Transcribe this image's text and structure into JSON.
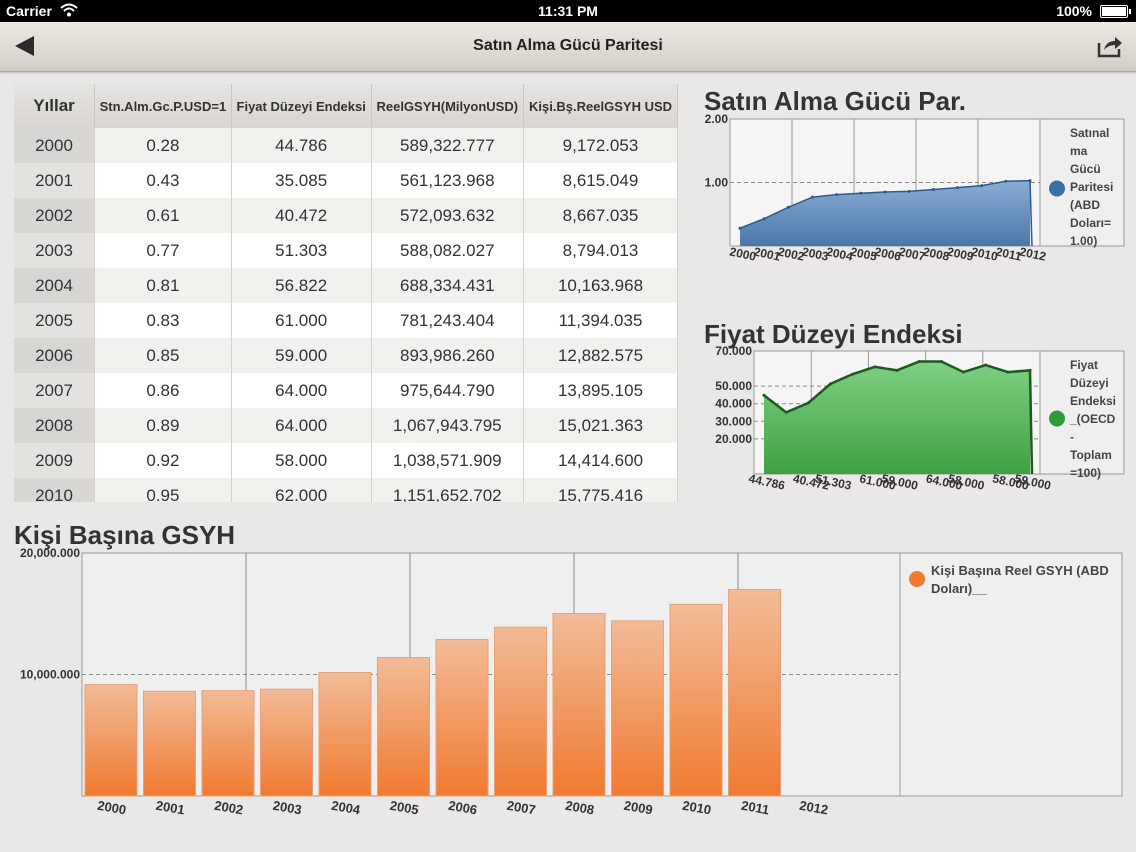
{
  "status_bar": {
    "carrier": "Carrier",
    "time": "11:31 PM",
    "battery": "100%"
  },
  "nav": {
    "title": "Satın Alma Gücü Paritesi"
  },
  "table": {
    "headers": [
      "Yıllar",
      "Stn.Alm.Gc.P.USD=1",
      "Fiyat Düzeyi Endeksi",
      "ReelGSYH(MilyonUSD)",
      "Kişi.Bş.ReelGSYH USD"
    ],
    "rows": [
      [
        "2000",
        "0.28",
        "44.786",
        "589,322.777",
        "9,172.053"
      ],
      [
        "2001",
        "0.43",
        "35.085",
        "561,123.968",
        "8,615.049"
      ],
      [
        "2002",
        "0.61",
        "40.472",
        "572,093.632",
        "8,667.035"
      ],
      [
        "2003",
        "0.77",
        "51.303",
        "588,082.027",
        "8,794.013"
      ],
      [
        "2004",
        "0.81",
        "56.822",
        "688,334.431",
        "10,163.968"
      ],
      [
        "2005",
        "0.83",
        "61.000",
        "781,243.404",
        "11,394.035"
      ],
      [
        "2006",
        "0.85",
        "59.000",
        "893,986.260",
        "12,882.575"
      ],
      [
        "2007",
        "0.86",
        "64.000",
        "975,644.790",
        "13,895.105"
      ],
      [
        "2008",
        "0.89",
        "64.000",
        "1,067,943.795",
        "15,021.363"
      ],
      [
        "2009",
        "0.92",
        "58.000",
        "1,038,571.909",
        "14,414.600"
      ],
      [
        "2010",
        "0.95",
        "62.000",
        "1,151,652.702",
        "15,775.416"
      ]
    ]
  },
  "chart_data": [
    {
      "type": "area",
      "title": "Satın Alma Gücü Par.",
      "x": [
        "2000",
        "2001",
        "2002",
        "2003",
        "2004",
        "2005",
        "2006",
        "2007",
        "2008",
        "2009",
        "2010",
        "2011",
        "2012"
      ],
      "series": [
        {
          "name": "Satınalma Gücü Paritesi (ABD Doları=1.00)",
          "values": [
            0.28,
            0.43,
            0.61,
            0.77,
            0.81,
            0.83,
            0.85,
            0.86,
            0.89,
            0.92,
            0.95,
            1.02,
            1.03
          ]
        }
      ],
      "y_ticks": [
        "2.00",
        "1.00"
      ],
      "ylim": [
        0,
        2
      ],
      "grid": true,
      "legend": "right",
      "color": "#3a6fa8",
      "legend_lines": [
        "Satınal",
        "ma",
        "Gücü",
        "Paritesi",
        "(ABD",
        "Doları=",
        "1.00)"
      ]
    },
    {
      "type": "area",
      "title": "Fiyat Düzeyi Endeksi",
      "x": [
        "44.786",
        "35.085",
        "40.472",
        "51.303",
        "56.822",
        "61.000",
        "59.000",
        "64.000",
        "64.000",
        "58.000",
        "62.000",
        "58.000",
        "59.000"
      ],
      "x_labels": [
        "44.786",
        "40.472",
        "51.303",
        "61.000",
        "59.000",
        "64.000",
        "58.000",
        "58.000",
        "59.000"
      ],
      "series": [
        {
          "name": "Fiyat Düzeyi Endeksi_(OECD - Toplam=100)",
          "values": [
            44.786,
            35.085,
            40.472,
            51.303,
            56.822,
            61.0,
            59.0,
            64.0,
            64.0,
            58.0,
            62.0,
            58.0,
            59.0
          ]
        }
      ],
      "y_ticks": [
        "70.000",
        "50.000",
        "40.000",
        "30.000",
        "20.000"
      ],
      "ylim": [
        0,
        70
      ],
      "grid": true,
      "legend": "right",
      "color": "#2f9a3a",
      "legend_lines": [
        "Fiyat",
        "Düzeyi",
        "Endeksi",
        "_(OECD",
        "-",
        "Toplam",
        "=100)"
      ]
    },
    {
      "type": "bar",
      "title": "Kişi Başına GSYH",
      "categories": [
        "2000",
        "2001",
        "2002",
        "2003",
        "2004",
        "2005",
        "2006",
        "2007",
        "2008",
        "2009",
        "2010",
        "2011",
        "2012"
      ],
      "series": [
        {
          "name": "Kişi Başına Reel GSYH (ABD Doları)__",
          "values": [
            9172.053,
            8615.049,
            8667.035,
            8794.013,
            10163.968,
            11394.035,
            12882.575,
            13895.105,
            15021.363,
            14414.6,
            15775.416,
            17000,
            null
          ]
        }
      ],
      "y_ticks": [
        "20,000.000",
        "10,000.000"
      ],
      "ylim": [
        0,
        20000
      ],
      "grid": true,
      "legend": "top-right",
      "color": "#f07a30",
      "legend_lines": [
        "Kişi Başına Reel GSYH (ABD",
        "Doları)__"
      ]
    }
  ]
}
